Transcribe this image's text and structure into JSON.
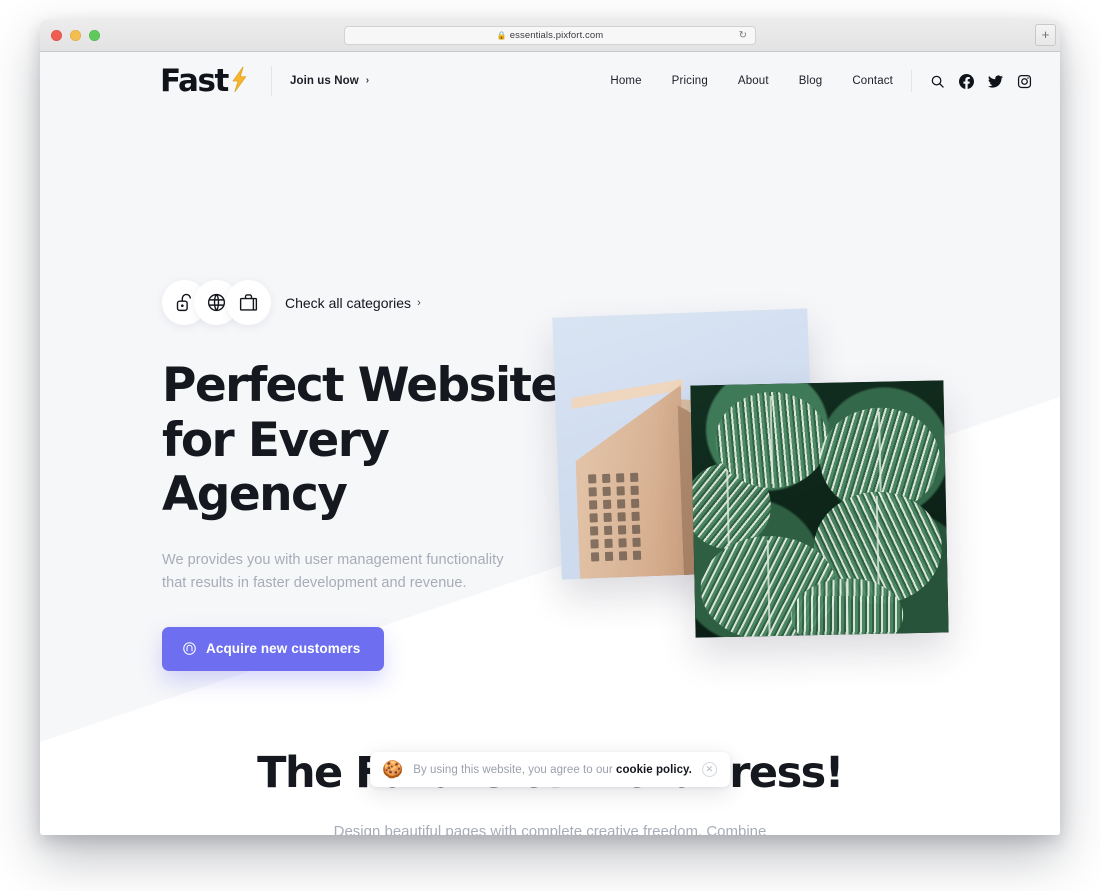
{
  "browser": {
    "url": "essentials.pixfort.com",
    "lock_icon": "lock-icon",
    "reload_icon": "reload-icon",
    "newtab_label": "+",
    "traffic_lights": {
      "close_color": "#f05b52",
      "minimize_color": "#f5bd4f",
      "zoom_color": "#5fc95b"
    }
  },
  "site_header": {
    "logo_text": "Fast",
    "logo_icon": "lightning-bolt-icon",
    "logo_bolt_color": "#f5b433",
    "join_us_label": "Join us Now",
    "join_us_chevron": "›",
    "nav": [
      {
        "label": "Home"
      },
      {
        "label": "Pricing"
      },
      {
        "label": "About"
      },
      {
        "label": "Blog"
      },
      {
        "label": "Contact"
      }
    ],
    "icons": [
      {
        "name": "search-icon"
      },
      {
        "name": "facebook-icon"
      },
      {
        "name": "twitter-icon"
      },
      {
        "name": "instagram-icon"
      }
    ]
  },
  "hero": {
    "categories": {
      "avatars": [
        {
          "icon": "unlocked-padlock-icon"
        },
        {
          "icon": "globe-icon"
        },
        {
          "icon": "shopping-bag-icon"
        }
      ],
      "link_label": "Check all categories",
      "link_chevron": "›"
    },
    "headline_line1": "Perfect Website",
    "headline_line2": "for Every Agency",
    "subtext_line1": "We provides you with user management functionality",
    "subtext_line2": "that results in faster development and revenue.",
    "cta": {
      "label": "Acquire new customers",
      "icon": "circled-umbrella-icon",
      "background_color": "#6e6ef0",
      "text_color": "#ffffff"
    },
    "images": [
      {
        "name": "building-photo",
        "alt": "Flatiron style building against pale blue sky"
      },
      {
        "name": "leaves-photo",
        "alt": "Dark green striped tropical leaves"
      }
    ],
    "band_color": "#f6f7f9"
  },
  "section2": {
    "title": "The Future of WordPress!",
    "body_line1": "Design beautiful pages with complete creative",
    "body_line2": "freedom. Combine seamlessly fitting layouts, customize everything"
  },
  "cookie_notice": {
    "emoji": "🍪",
    "text_prefix": "By using this website, you agree to our ",
    "link_label": "cookie policy.",
    "close_icon": "close-circle-icon",
    "close_glyph": "✕"
  }
}
